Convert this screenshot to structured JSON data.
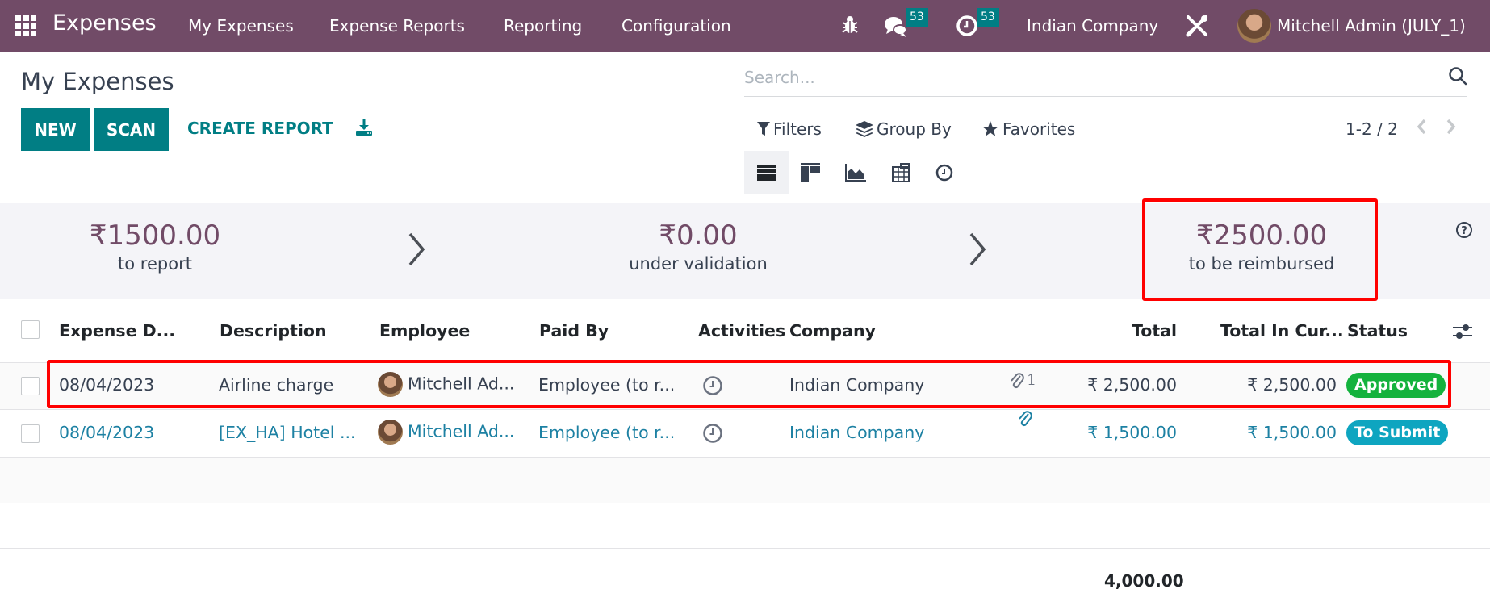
{
  "navbar": {
    "app_name": "Expenses",
    "menu": [
      "My Expenses",
      "Expense Reports",
      "Reporting",
      "Configuration"
    ],
    "messages_count": "53",
    "activities_count": "53",
    "company": "Indian Company",
    "user": "Mitchell Admin (JULY_1)"
  },
  "control": {
    "title": "My Expenses",
    "new_label": "NEW",
    "scan_label": "SCAN",
    "create_report_label": "CREATE REPORT",
    "search_placeholder": "Search...",
    "filters_label": "Filters",
    "group_by_label": "Group By",
    "favorites_label": "Favorites",
    "pager": "1-2 / 2",
    "views": [
      "list",
      "kanban",
      "graph",
      "pivot",
      "activity"
    ],
    "active_view": "list"
  },
  "summary": [
    {
      "amount": "₹1500.00",
      "label": "to report"
    },
    {
      "amount": "₹0.00",
      "label": "under validation"
    },
    {
      "amount": "₹2500.00",
      "label": "to be reimbursed"
    }
  ],
  "table": {
    "columns": [
      "Expense D...",
      "Description",
      "Employee",
      "Paid By",
      "Activities",
      "Company",
      "",
      "Total",
      "Total In Cur...",
      "Status"
    ],
    "rows": [
      {
        "date": "08/04/2023",
        "description": "Airline charge",
        "employee": "Mitchell Ad...",
        "paid_by": "Employee (to r...",
        "company": "Indian Company",
        "attachments": "1",
        "total": "₹ 2,500.00",
        "total_currency": "₹ 2,500.00",
        "status": "Approved",
        "status_color": "#14b23d"
      },
      {
        "date": "08/04/2023",
        "description": "[EX_HA] Hotel ...",
        "employee": "Mitchell Ad...",
        "paid_by": "Employee (to r...",
        "company": "Indian Company",
        "attachments": "",
        "total": "₹ 1,500.00",
        "total_currency": "₹ 1,500.00",
        "status": "To Submit",
        "status_color": "#0ea5c0"
      }
    ],
    "footer_total": "4,000.00"
  },
  "colors": {
    "brand": "#714b67",
    "primary": "#017e84",
    "link": "#1d81a3",
    "highlight": "#ff0000"
  }
}
